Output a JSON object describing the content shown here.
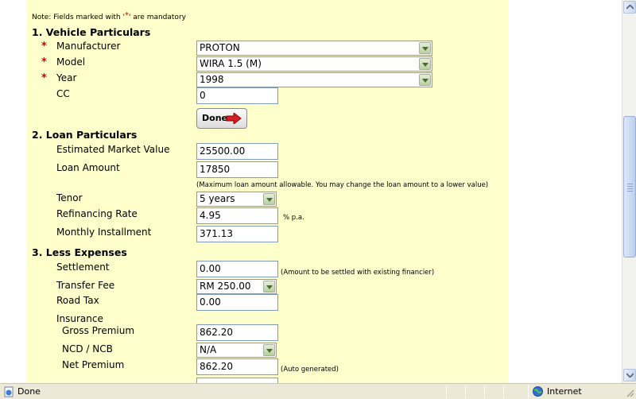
{
  "note": {
    "prefix": "Note: Fields marked with '",
    "star": "*",
    "suffix": "' are mandatory"
  },
  "sections": {
    "vehicle": "1. Vehicle Particulars",
    "loan": "2. Loan Particulars",
    "expenses": "3. Less Expenses"
  },
  "required_mark": "*",
  "vehicle": {
    "manufacturer_label": "Manufacturer",
    "manufacturer_value": "PROTON",
    "model_label": "Model",
    "model_value": "WIRA 1.5 (M)",
    "year_label": "Year",
    "year_value": "1998",
    "cc_label": "CC",
    "cc_value": "0",
    "done_label": "Done"
  },
  "loan": {
    "emv_label": "Estimated Market Value",
    "emv_value": "25500.00",
    "amount_label": "Loan Amount",
    "amount_value": "17850",
    "amount_hint": "(Maximum loan amount allowable. You may change the loan amount to a lower value)",
    "tenor_label": "Tenor",
    "tenor_value": "5 years",
    "rate_label": "Refinancing Rate",
    "rate_value": "4.95",
    "rate_unit": "% p.a.",
    "install_label": "Monthly Installment",
    "install_value": "371.13"
  },
  "expenses": {
    "settlement_label": "Settlement",
    "settlement_value": "0.00",
    "settlement_hint": "(Amount to be settled with existing financier)",
    "transfer_label": "Transfer Fee",
    "transfer_value": "RM 250.00",
    "roadtax_label": "Road Tax",
    "roadtax_value": "0.00",
    "insurance_label": "Insurance",
    "gross_label": "Gross Premium",
    "gross_value": "862.20",
    "ncd_label": "NCD / NCB",
    "ncd_value": "N/A",
    "net_label": "Net Premium",
    "net_value": "862.20",
    "net_hint": "(Auto generated)"
  },
  "status": {
    "text": "Done",
    "zone": "Internet"
  },
  "colors": {
    "form_bg": "#ffffcc",
    "required": "#cc0000",
    "field_border": "#7f9db9"
  }
}
